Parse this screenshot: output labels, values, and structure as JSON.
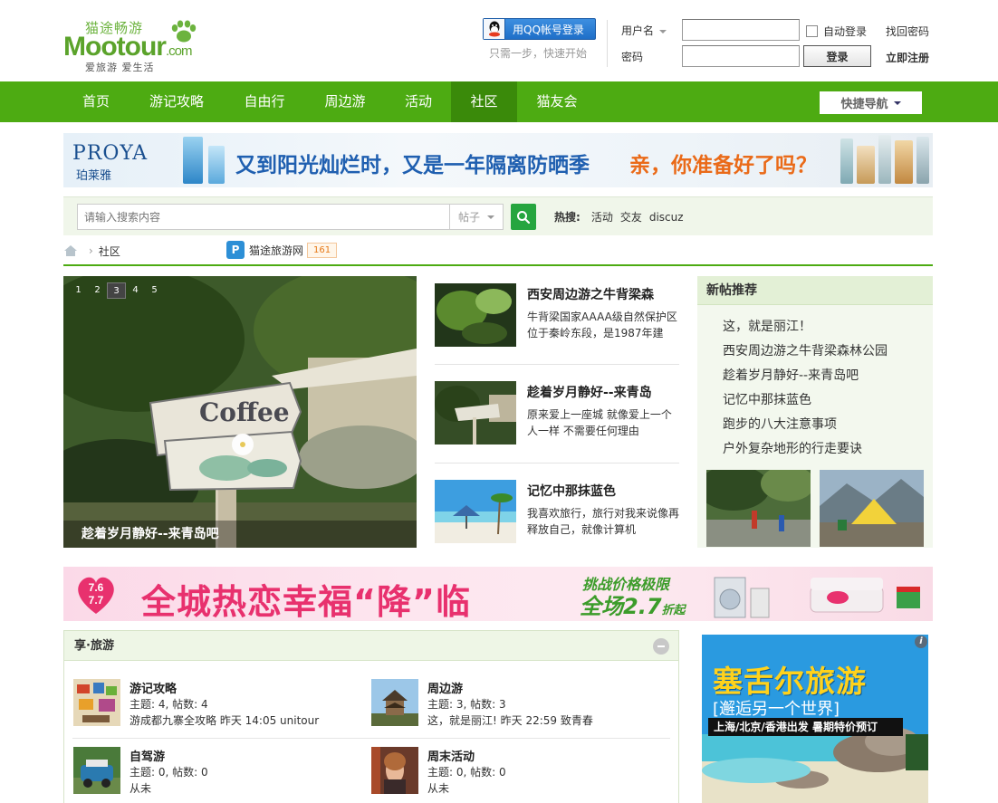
{
  "header": {
    "logo_cn": "猫途畅游",
    "logo_en": "Mootour",
    "logo_com": ".com",
    "logo_slogan": "爱旅游  爱生活",
    "qq_login": "用QQ帐号登录",
    "qq_tip": "只需一步，快速开始",
    "username_label": "用户名",
    "password_label": "密码",
    "auto_login": "自动登录",
    "login_button": "登录",
    "forgot_password": "找回密码",
    "register": "立即注册"
  },
  "nav": {
    "items": [
      "首页",
      "游记攻略",
      "自由行",
      "周边游",
      "活动",
      "社区",
      "猫友会"
    ],
    "active": "社区",
    "quick_nav": "快捷导航"
  },
  "banner_top": {
    "brand": "PROYA",
    "brand_cn": "珀莱雅",
    "text1": "又到阳光灿烂时，又是一年隔离防晒季",
    "text2": "亲，你准备好了吗？"
  },
  "search": {
    "placeholder": "请输入搜索内容",
    "type": "帖子",
    "hot_label": "热搜:",
    "hot_terms": [
      "活动",
      "交友",
      "discuz"
    ]
  },
  "breadcrumb": {
    "current": "社区",
    "site_name": "猫途旅游网",
    "site_count": "161"
  },
  "slideshow": {
    "pages": [
      "1",
      "2",
      "3",
      "4",
      "5"
    ],
    "active_page": "3",
    "caption": "趁着岁月静好--来青岛吧",
    "sign_text": "Coffee"
  },
  "articles": [
    {
      "title": "西安周边游之牛背梁森",
      "desc": "牛背梁国家AAAA级自然保护区位于秦岭东段，是1987年建"
    },
    {
      "title": "趁着岁月静好--来青岛",
      "desc": "原来爱上一座城 就像爱上一个人一样 不需要任何理由"
    },
    {
      "title": "记忆中那抹蓝色",
      "desc": "我喜欢旅行，旅行对我来说像再释放自己，就像计算机"
    }
  ],
  "new_posts": {
    "title": "新帖推荐",
    "items": [
      "这，就是丽江！",
      "西安周边游之牛背梁森林公园",
      "趁着岁月静好--来青岛吧",
      "记忆中那抹蓝色",
      "跑步的八大注意事项",
      "户外复杂地形的行走要诀"
    ]
  },
  "banner_mid": {
    "date_top": "7.6",
    "date_bottom": "7.7",
    "main": "全城热恋幸福“降”临",
    "line1": "挑战价格极限",
    "line2": "全场2.7",
    "line2_suffix": "折起"
  },
  "forum": {
    "title": "享·旅游",
    "boards": [
      {
        "name": "游记攻略",
        "stats": "主题: 4, 帖数: 4",
        "last": "游成都九寨全攻略  昨天 14:05 unitour"
      },
      {
        "name": "周边游",
        "stats": "主题: 3, 帖数: 3",
        "last": "这，就是丽江! 昨天 22:59 致青春"
      },
      {
        "name": "自驾游",
        "stats": "主题: 0, 帖数: 0",
        "last": "从未"
      },
      {
        "name": "周末活动",
        "stats": "主题: 0, 帖数: 0",
        "last": "从未"
      }
    ]
  },
  "ad": {
    "title": "塞舌尔旅游",
    "subtitle": "[邂逅另一个世界]",
    "strip": "上海/北京/香港出发  暑期特价预订",
    "info": "i"
  },
  "colors": {
    "brand_green": "#4dab12",
    "nav_active": "#3a8a0a",
    "qq_blue": "#1f6fc8",
    "search_button": "#26a53f"
  }
}
